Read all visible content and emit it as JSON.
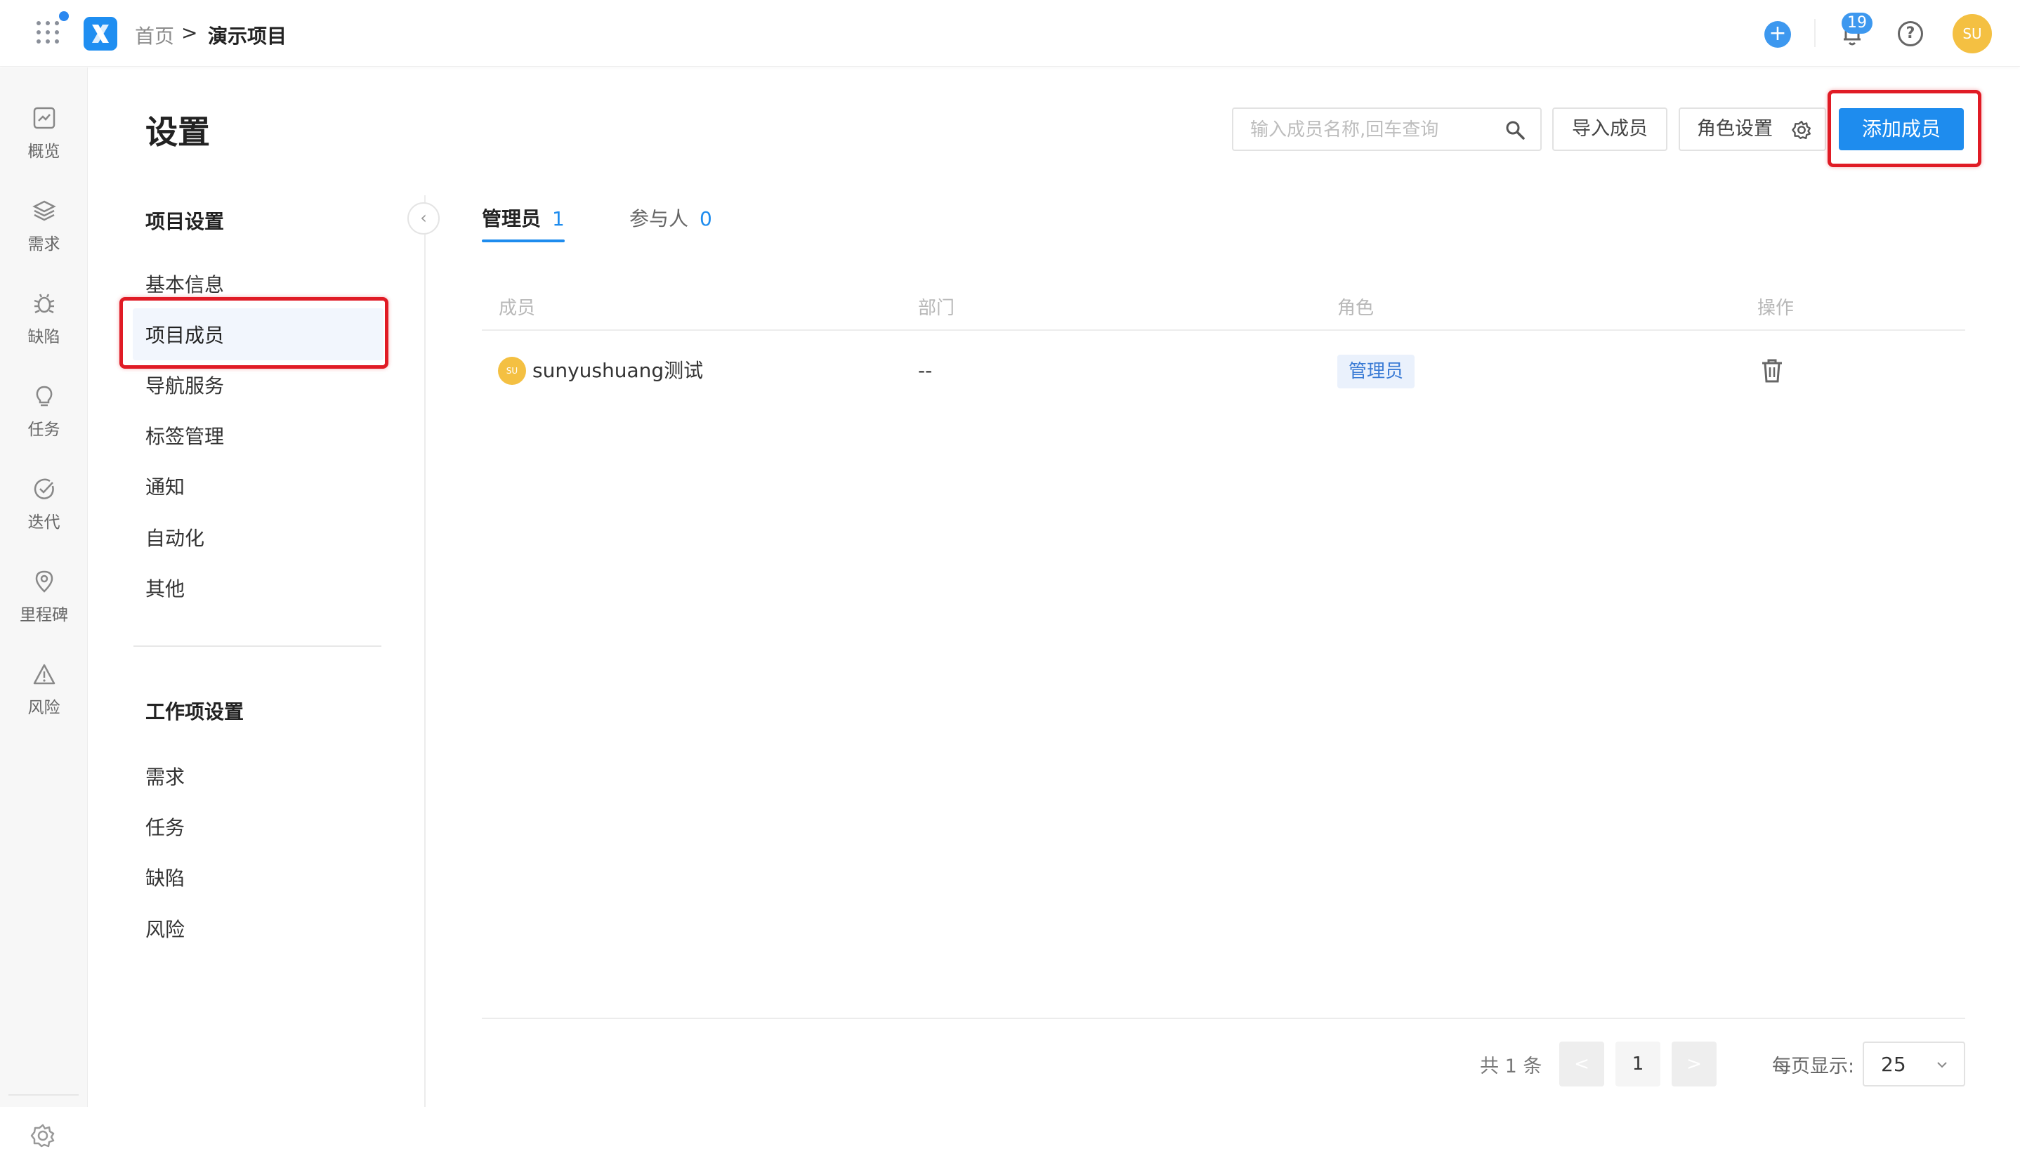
{
  "header": {
    "breadcrumb_home": "首页",
    "breadcrumb_sep": ">",
    "breadcrumb_current": "演示项目",
    "notification_count": "19",
    "user_initials": "SU"
  },
  "leftnav": {
    "items": [
      {
        "label": "概览",
        "icon": "chart-icon"
      },
      {
        "label": "需求",
        "icon": "layers-icon"
      },
      {
        "label": "缺陷",
        "icon": "bug-icon"
      },
      {
        "label": "任务",
        "icon": "lightbulb-icon"
      },
      {
        "label": "迭代",
        "icon": "check-circle-icon"
      },
      {
        "label": "里程碑",
        "icon": "location-pin-icon"
      },
      {
        "label": "风险",
        "icon": "warning-icon"
      }
    ]
  },
  "page": {
    "title": "设置"
  },
  "settings_nav": {
    "project_group": "项目设置",
    "project_items": [
      "基本信息",
      "项目成员",
      "导航服务",
      "标签管理",
      "通知",
      "自动化",
      "其他"
    ],
    "active_item": "项目成员",
    "workitem_group": "工作项设置",
    "workitem_items": [
      "需求",
      "任务",
      "缺陷",
      "风险"
    ]
  },
  "toolbar": {
    "search_placeholder": "输入成员名称,回车查询",
    "import_label": "导入成员",
    "role_settings_label": "角色设置",
    "add_member_label": "添加成员"
  },
  "tabs": [
    {
      "label": "管理员",
      "count": "1",
      "active": true
    },
    {
      "label": "参与人",
      "count": "0",
      "active": false
    }
  ],
  "table": {
    "headers": [
      "成员",
      "部门",
      "角色",
      "操作"
    ],
    "rows": [
      {
        "avatar": "SU",
        "member": "sunyushuang测试",
        "department": "--",
        "role": "管理员"
      }
    ]
  },
  "pagination": {
    "total_text": "共 1 条",
    "prev": "<",
    "current_page": "1",
    "next": ">",
    "page_size_label": "每页显示:",
    "page_size": "25"
  },
  "colors": {
    "primary": "#1e8cee",
    "highlight_border": "#e01b25",
    "avatar": "#f4c042"
  }
}
